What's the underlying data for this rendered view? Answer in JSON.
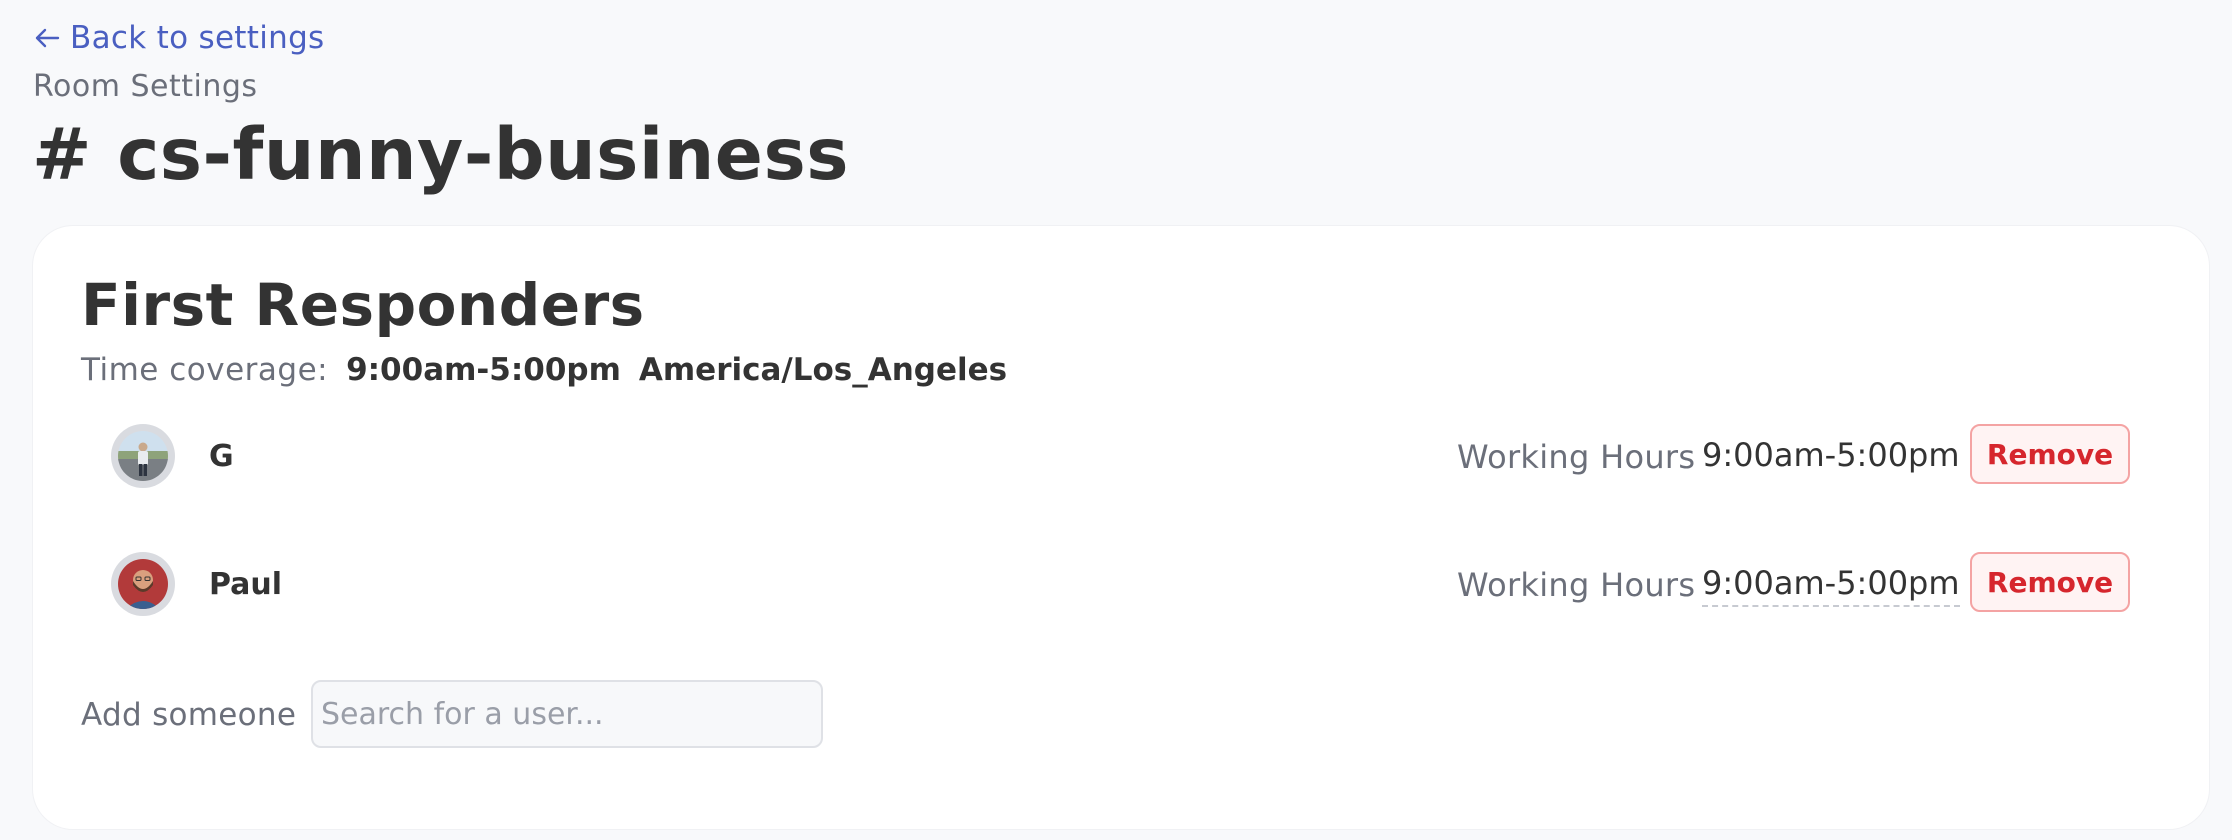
{
  "nav": {
    "back_label": "Back to settings"
  },
  "header": {
    "subtitle": "Room Settings",
    "title": "# cs-funny-business"
  },
  "first_responders": {
    "title": "First Responders",
    "coverage_label": "Time coverage:",
    "coverage_time": "9:00am-5:00pm",
    "coverage_timezone": "America/Los_Angeles",
    "responders": [
      {
        "name": "G",
        "working_hours_label": "Working Hours",
        "working_hours": "9:00am-5:00pm",
        "remove_label": "Remove",
        "avatar_icon": "user-photo-outdoor"
      },
      {
        "name": "Paul",
        "working_hours_label": "Working Hours",
        "working_hours": "9:00am-5:00pm",
        "remove_label": "Remove",
        "avatar_icon": "user-photo-portrait"
      }
    ],
    "add_label": "Add someone",
    "search_placeholder": "Search for a user..."
  },
  "colors": {
    "link": "#4a5fc1",
    "danger": "#d6262d",
    "danger_bg": "#fff3f3",
    "page_bg": "#f8f9fb"
  }
}
